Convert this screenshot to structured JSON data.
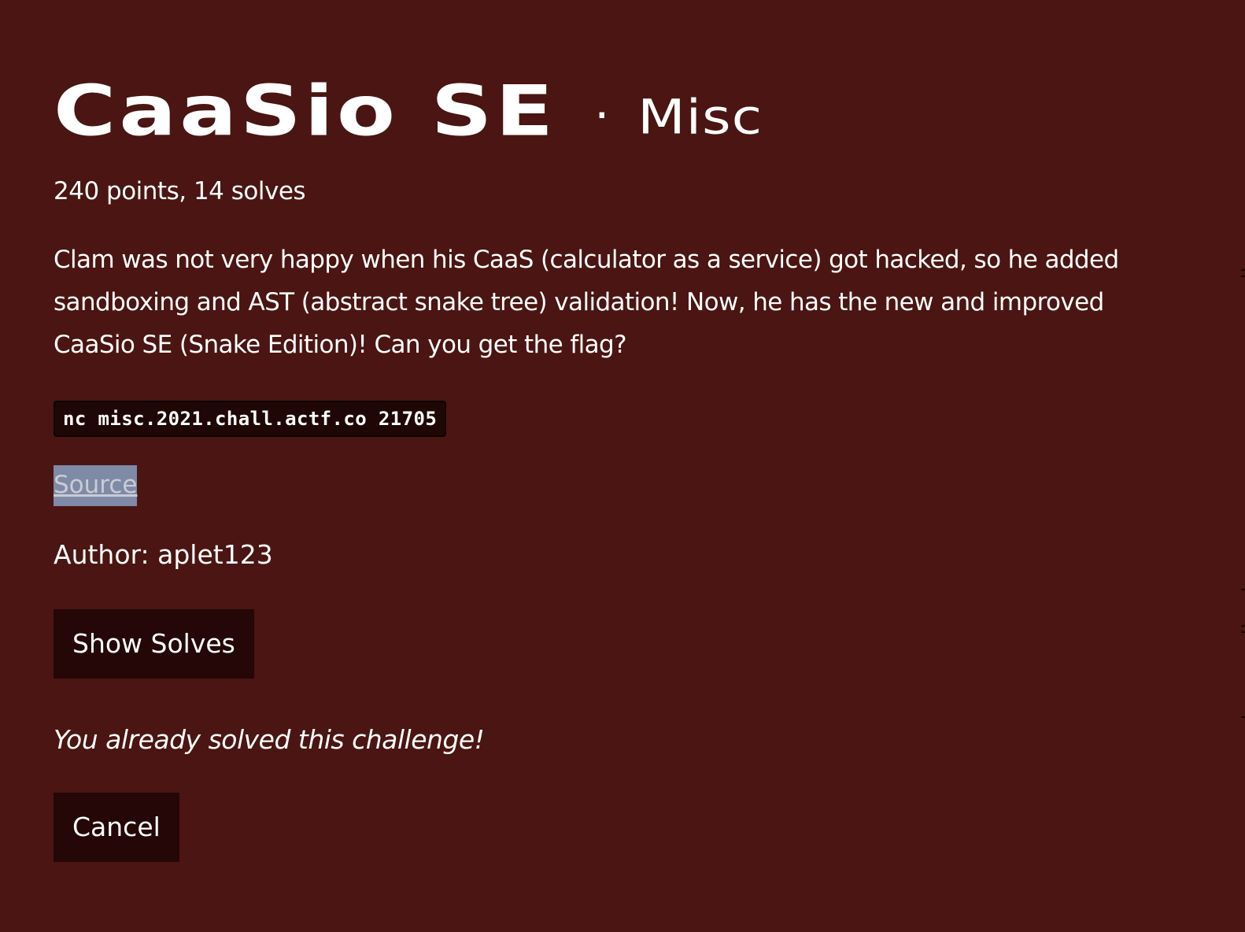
{
  "challenge": {
    "title": "CaaSio SE",
    "separator": "·",
    "category": "Misc",
    "stats": "240 points, 14 solves",
    "description": "Clam was not very happy when his CaaS (calculator as a service) got hacked, so he added sandboxing and AST (abstract snake tree) validation! Now, he has the new and improved CaaSio SE (Snake Edition)! Can you get the flag?",
    "command": "nc misc.2021.chall.actf.co 21705",
    "source_link": "Source",
    "author": "Author: aplet123",
    "solved_message": "You already solved this challenge!"
  },
  "buttons": {
    "show_solves": "Show Solves",
    "cancel": "Cancel"
  },
  "colors": {
    "background": "#4a1512",
    "button_bg": "#240706",
    "code_bg": "#1f0706",
    "link_highlight": "#7f8aa6"
  }
}
